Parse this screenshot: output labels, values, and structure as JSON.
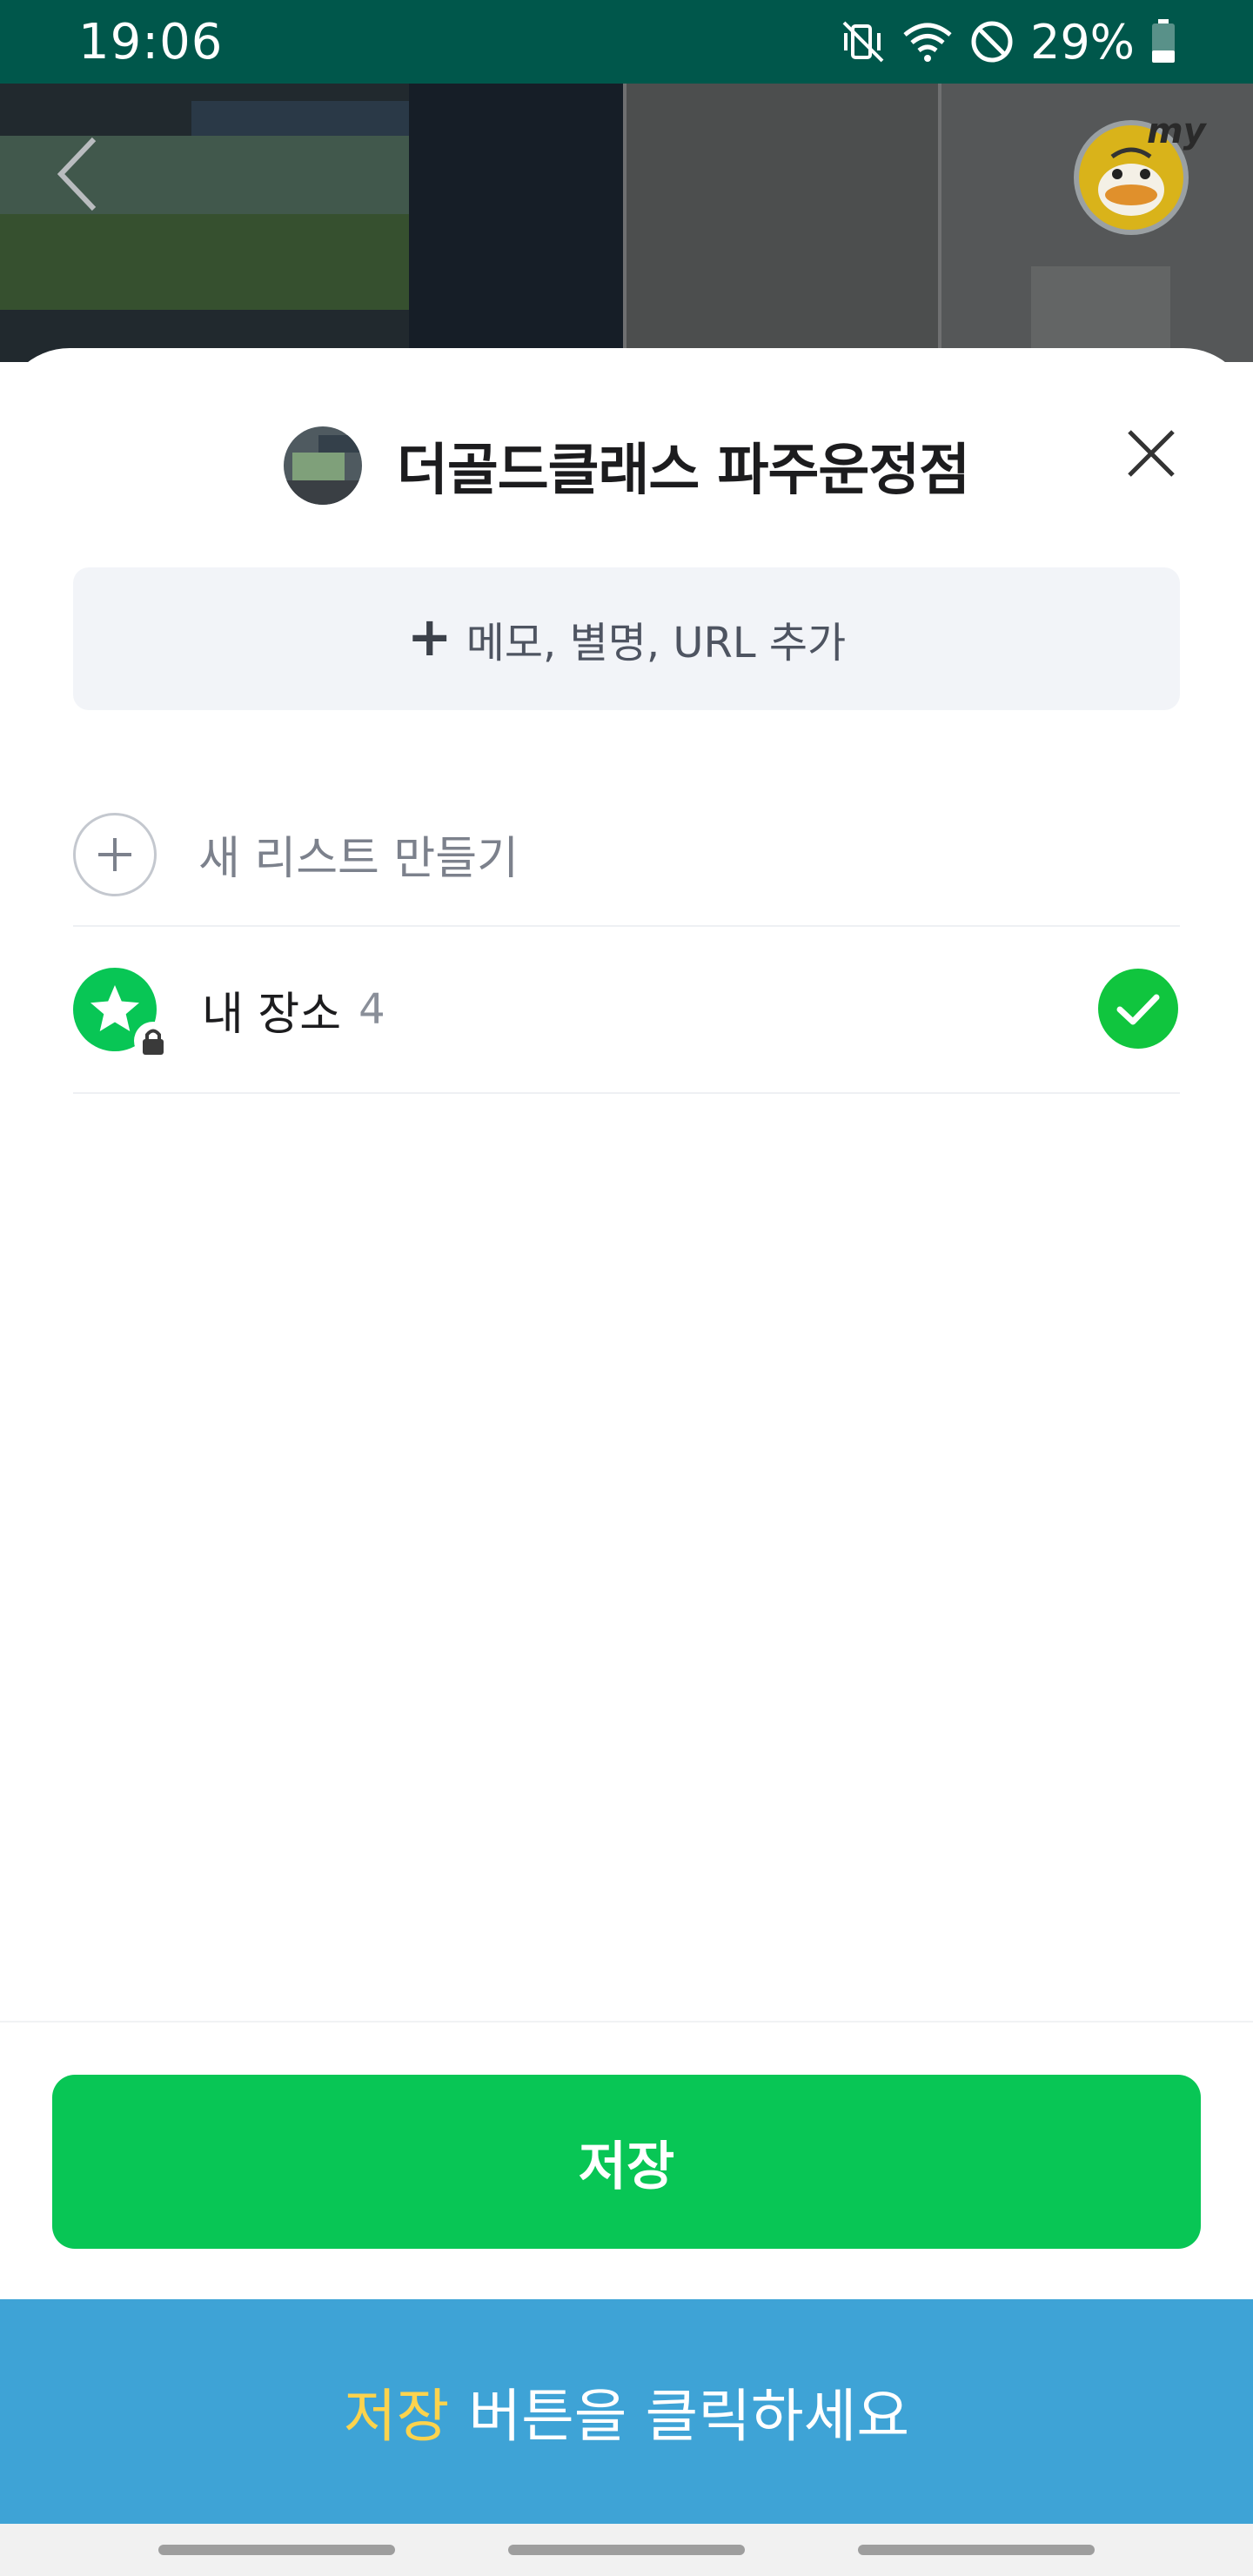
{
  "status_bar": {
    "time": "19:06",
    "battery_percent": "29%",
    "icons": [
      "vibrate-mute-icon",
      "wifi-icon",
      "do-not-disturb-icon",
      "battery-icon"
    ]
  },
  "top": {
    "back_icon": "chevron-left-icon",
    "avatar_badge": "my"
  },
  "sheet": {
    "title": "더골드클래스 파주운정점",
    "memo_button_label": "메모, 별명, URL 추가",
    "new_list_label": "새 리스트 만들기",
    "lists": [
      {
        "label": "내 장소",
        "count": "4",
        "checked": true,
        "icon": "star-lock-icon"
      }
    ],
    "save_label": "저장"
  },
  "hint_banner": {
    "highlight": "저장",
    "text": "버튼을 클릭하세요"
  },
  "colors": {
    "status_bar": "#00574b",
    "accent_green": "#08c655",
    "banner_blue": "#3ea3d6",
    "banner_highlight": "#fcd34d"
  }
}
